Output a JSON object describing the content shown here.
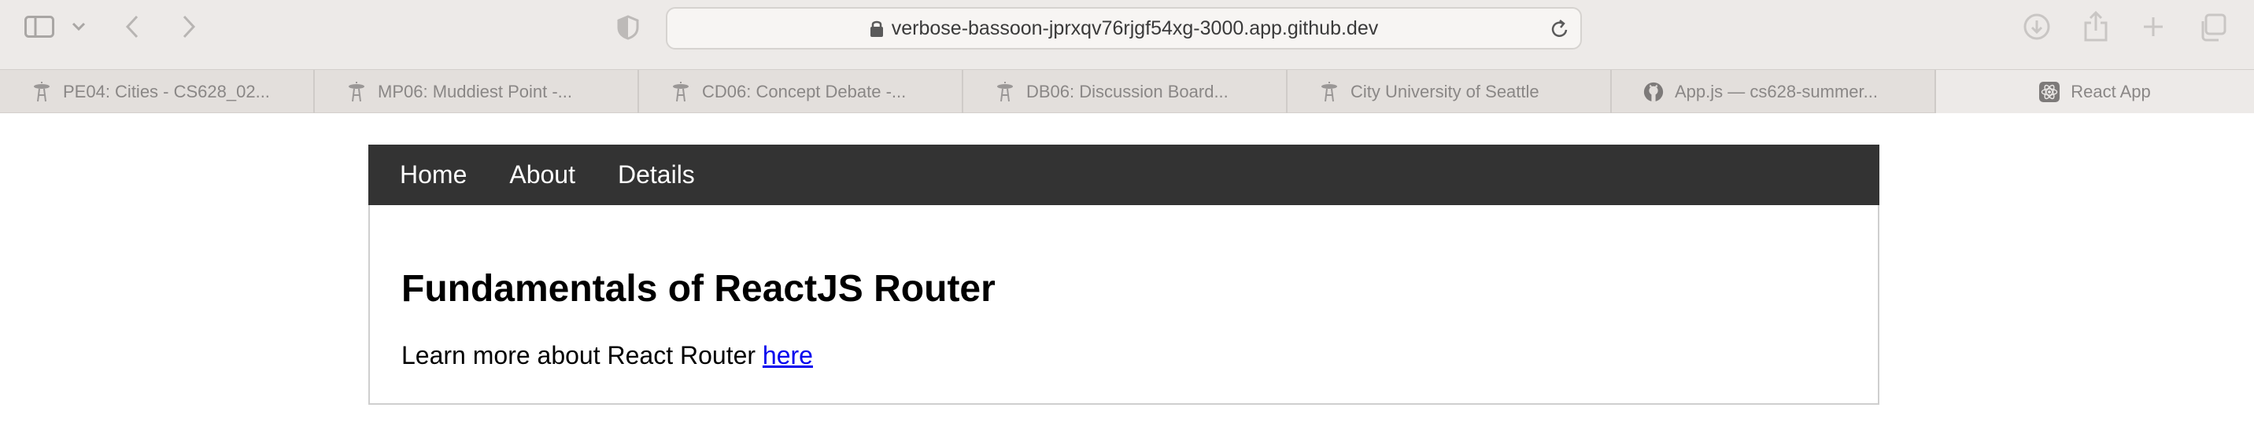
{
  "browser": {
    "url": "verbose-bassoon-jprxqv76rjgf54xg-3000.app.github.dev",
    "icons": {
      "sidebar": "sidebar-icon",
      "tab_overview_menu": "chevron-down-icon",
      "back": "back-arrow-icon",
      "forward": "forward-arrow-icon",
      "privacy": "shield-icon",
      "lock": "lock-icon",
      "reload": "reload-icon",
      "downloads": "download-icon",
      "share": "share-icon",
      "new_tab": "plus-icon",
      "tab_overview": "tabs-overview-icon"
    }
  },
  "tabs": [
    {
      "title": "PE04: Cities - CS628_02...",
      "icon": "space-needle-icon"
    },
    {
      "title": "MP06: Muddiest Point -...",
      "icon": "space-needle-icon"
    },
    {
      "title": "CD06: Concept Debate -...",
      "icon": "space-needle-icon"
    },
    {
      "title": "DB06: Discussion Board...",
      "icon": "space-needle-icon"
    },
    {
      "title": "City University of Seattle",
      "icon": "space-needle-icon"
    },
    {
      "title": "App.js — cs628-summer...",
      "icon": "github-icon"
    },
    {
      "title": "React App",
      "icon": "react-icon",
      "active": true
    }
  ],
  "page": {
    "nav": {
      "home": "Home",
      "about": "About",
      "details": "Details"
    },
    "heading": "Fundamentals of ReactJS Router",
    "text": "Learn more about React Router",
    "link": "here",
    "colors": {
      "nav_background": "#333333",
      "link": "#0000ee"
    }
  }
}
